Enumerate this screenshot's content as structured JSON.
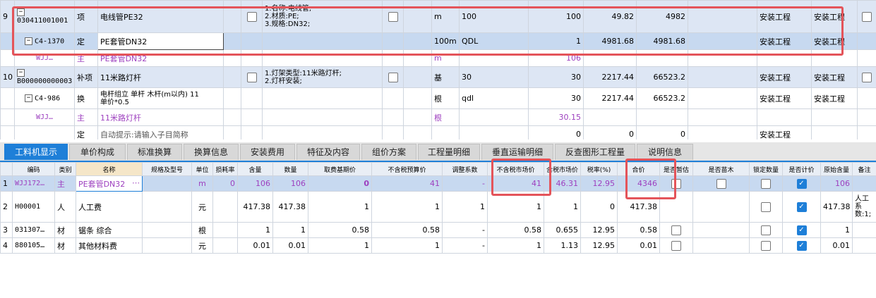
{
  "upper": {
    "r9": {
      "idx": "9",
      "code": "030411001001",
      "type": "项",
      "name": "电线管PE32",
      "spec_l1": "1.名称:电线管;",
      "spec_l2": "2.材质:PE;",
      "spec_l3": "3.规格:DN32;",
      "unit": "m",
      "qty": "100",
      "qty2": "100",
      "price": "49.82",
      "total": "4982",
      "cat1": "安装工程",
      "cat2": "安装工程"
    },
    "r9a": {
      "code": "C4-1370",
      "type": "定",
      "name": "PE套管DN32",
      "unit": "100m",
      "qty": "QDL",
      "qty2": "1",
      "price": "4981.68",
      "total": "4981.68",
      "cat1": "安装工程",
      "cat2": "安装工程"
    },
    "r9b": {
      "code": "WJJ…",
      "type": "主",
      "name": "PE套管DN32",
      "unit": "m",
      "qty2": "106"
    },
    "r10": {
      "idx": "10",
      "code": "B000000000003",
      "type": "补项",
      "name": "11米路灯杆",
      "spec_l1": "1.灯架类型:11米路灯杆;",
      "spec_l2": "2.灯杆安装;",
      "unit": "基",
      "qty": "30",
      "qty2": "30",
      "price": "2217.44",
      "total": "66523.2",
      "cat1": "安装工程",
      "cat2": "安装工程"
    },
    "r10a": {
      "code": "C4-986",
      "type": "换",
      "name_l1": "电杆组立 单杆 木杆(m以内) 11",
      "name_l2": "单价*0.5",
      "unit": "根",
      "qty": "qdl",
      "qty2": "30",
      "price": "2217.44",
      "total": "66523.2",
      "cat1": "安装工程",
      "cat2": "安装工程"
    },
    "r10b": {
      "code": "WJJ…",
      "type": "主",
      "name": "11米路灯杆",
      "unit": "根",
      "qty2": "30.15"
    },
    "r11": {
      "type": "定",
      "name": "自动提示:请输入子目简称",
      "qty2": "0",
      "price": "0",
      "total": "0",
      "cat1": "安装工程"
    }
  },
  "tabs": [
    "工料机显示",
    "单价构成",
    "标准换算",
    "换算信息",
    "安装费用",
    "特征及内容",
    "组价方案",
    "工程量明细",
    "垂直运输明细",
    "反查图形工程量",
    "说明信息"
  ],
  "headers": [
    "编码",
    "类别",
    "名称",
    "规格及型号",
    "单位",
    "损耗率",
    "含量",
    "数量",
    "取费基期价",
    "不含税预算价",
    "调整系数",
    "不含税市场价",
    "含税市场价",
    "税率(%)",
    "合价",
    "是否暂估",
    "是否苗木",
    "锁定数量",
    "是否计价",
    "原始含量",
    "备注"
  ],
  "rows": [
    {
      "idx": "1",
      "code": "WJJ172…",
      "type": "主",
      "name": "PE套管DN32",
      "unit": "m",
      "loss": "0",
      "content": "106",
      "qty": "106",
      "base": "0",
      "budget": "41",
      "adjust": "-",
      "market": "41",
      "market_tax": "46.31",
      "tax": "12.95",
      "total": "4346",
      "orig": "106",
      "remark": ""
    },
    {
      "idx": "2",
      "code": "H00001",
      "type": "人",
      "name": "人工费",
      "unit": "元",
      "loss": "",
      "content": "417.38",
      "qty": "417.38",
      "base": "1",
      "budget": "1",
      "adjust": "1",
      "market": "1",
      "market_tax": "1",
      "tax": "0",
      "total": "417.38",
      "orig": "417.38",
      "remark": "人工系数:1;"
    },
    {
      "idx": "3",
      "code": "031307…",
      "type": "材",
      "name": "锯条 综合",
      "unit": "根",
      "loss": "",
      "content": "1",
      "qty": "1",
      "base": "0.58",
      "budget": "0.58",
      "adjust": "-",
      "market": "0.58",
      "market_tax": "0.655",
      "tax": "12.95",
      "total": "0.58",
      "orig": "1",
      "remark": ""
    },
    {
      "idx": "4",
      "code": "880105…",
      "type": "材",
      "name": "其他材料费",
      "unit": "元",
      "loss": "",
      "content": "0.01",
      "qty": "0.01",
      "base": "1",
      "budget": "1",
      "adjust": "-",
      "market": "1",
      "market_tax": "1.13",
      "tax": "12.95",
      "total": "0.01",
      "orig": "0.01",
      "remark": ""
    }
  ],
  "colors": {
    "accent": "#1e7fd8",
    "highlight": "#e4545a",
    "purple": "#9d3fbf"
  },
  "icons": {
    "expand": "tree-expand-icon",
    "checkbox": "checkbox-icon"
  }
}
